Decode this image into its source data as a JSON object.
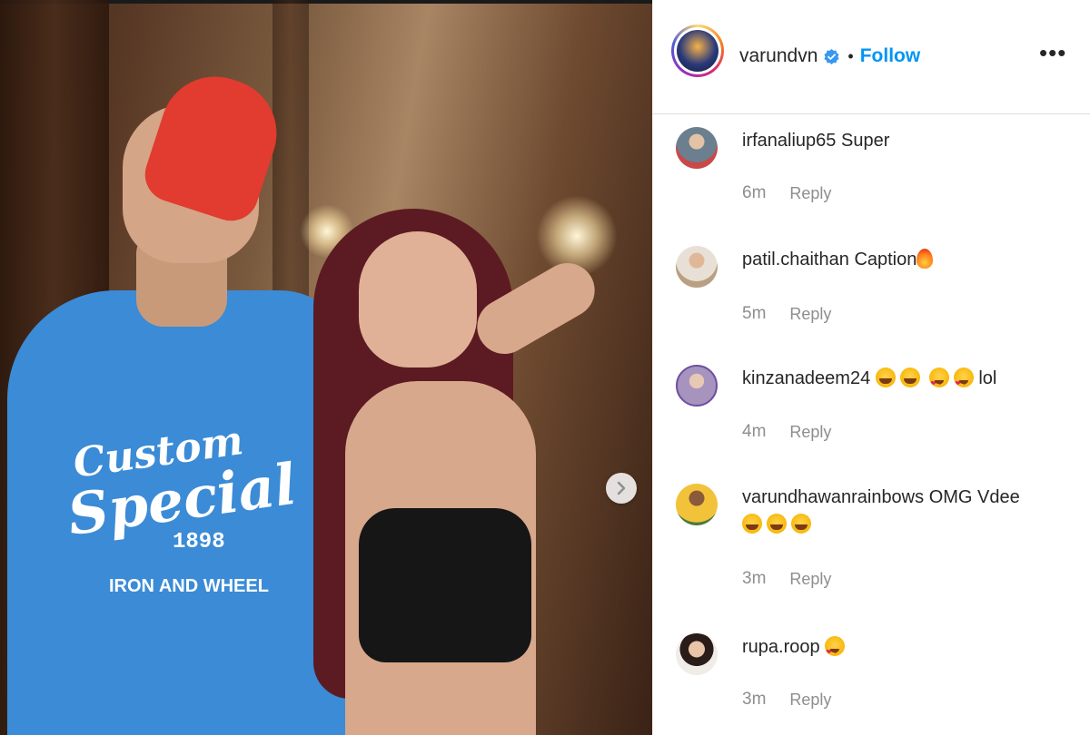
{
  "post": {
    "author": "varundvn",
    "follow_label": "Follow",
    "dot": "•",
    "more_label": "•••",
    "verified": true
  },
  "colors": {
    "follow_blue": "#0095f6",
    "muted_gray": "#8e8e8e",
    "text_dark": "#262626"
  },
  "photo": {
    "shirt_line1": "Custom",
    "shirt_line2": "Special",
    "shirt_year": "1898",
    "shirt_line4": "IRON AND WHEEL",
    "next_icon": "chevron-right-icon"
  },
  "comments": [
    {
      "username": "irfanaliup65",
      "text": "Super",
      "time": "6m",
      "reply_label": "Reply",
      "avatar_color": "#6b7f8f"
    },
    {
      "username": "patil.chaithan",
      "text": "Caption",
      "emoji": [
        "fire"
      ],
      "time": "5m",
      "reply_label": "Reply",
      "avatar_color": "#b8a080"
    },
    {
      "username": "kinzanadeem24",
      "text": "lol",
      "emoji_before_text": [
        "joy",
        "joy",
        "heart",
        "heart"
      ],
      "time": "4m",
      "reply_label": "Reply",
      "avatar_color": "#9a88a8"
    },
    {
      "username": "varundhawanrainbows",
      "text": "OMG Vdee",
      "emoji_line2": [
        "joy",
        "joy",
        "joy"
      ],
      "time": "3m",
      "reply_label": "Reply",
      "avatar_color": "#d9a640"
    },
    {
      "username": "rupa.roop",
      "text": "",
      "emoji": [
        "heart"
      ],
      "time": "3m",
      "reply_label": "Reply",
      "avatar_color": "#c7b8a8"
    }
  ]
}
